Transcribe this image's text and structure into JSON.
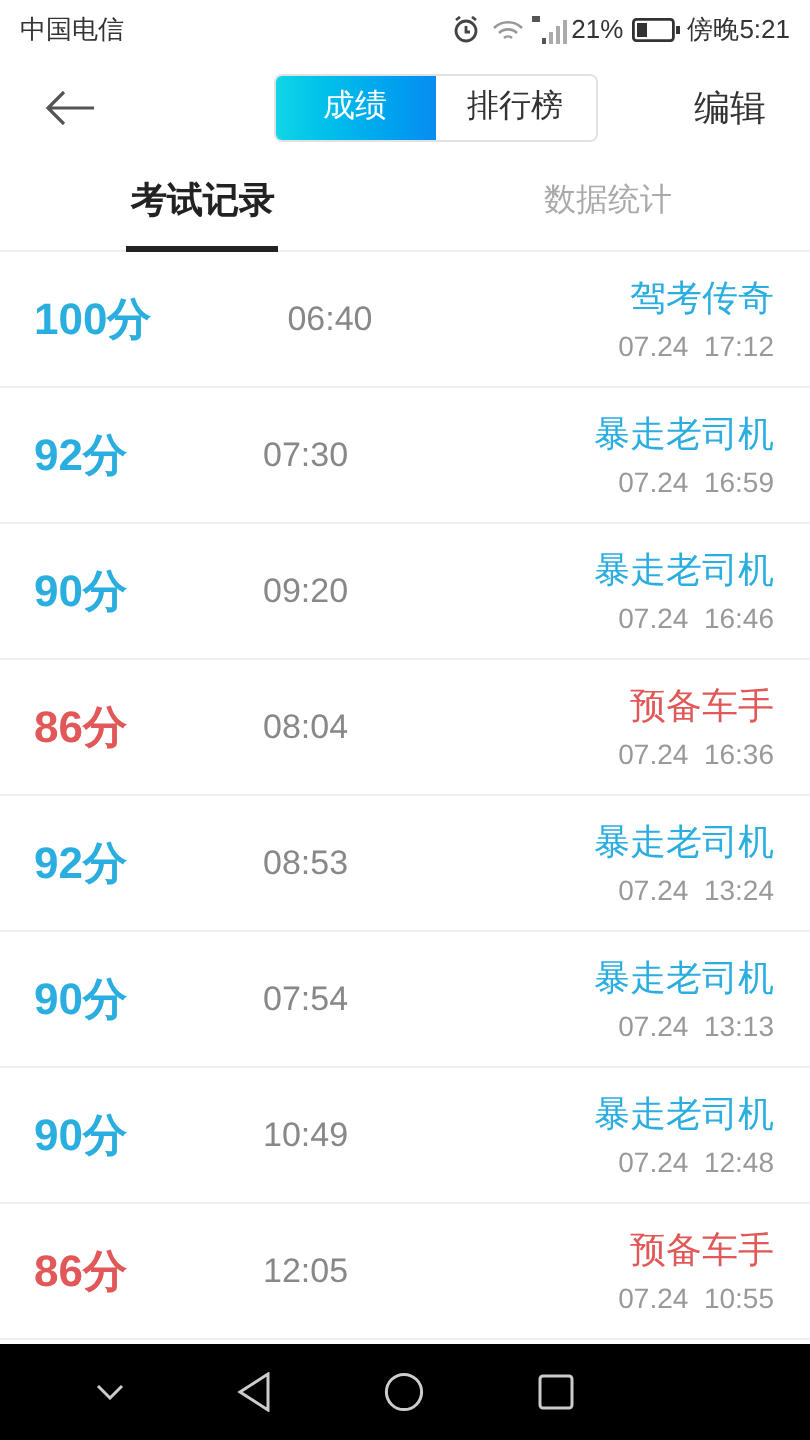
{
  "status_bar": {
    "carrier": "中国电信",
    "battery_percent": "21%",
    "time": "傍晚5:21"
  },
  "header": {
    "segments": [
      {
        "label": "成绩",
        "selected": true
      },
      {
        "label": "排行榜",
        "selected": false
      }
    ],
    "edit": "编辑"
  },
  "tabs": [
    {
      "label": "考试记录",
      "selected": true
    },
    {
      "label": "数据统计",
      "selected": false
    }
  ],
  "records": [
    {
      "score": "100分",
      "duration": "06:40",
      "title": "驾考传奇",
      "datetime": "07.24  17:12",
      "passed": true
    },
    {
      "score": "92分",
      "duration": "07:30",
      "title": "暴走老司机",
      "datetime": "07.24  16:59",
      "passed": true
    },
    {
      "score": "90分",
      "duration": "09:20",
      "title": "暴走老司机",
      "datetime": "07.24  16:46",
      "passed": true
    },
    {
      "score": "86分",
      "duration": "08:04",
      "title": "预备车手",
      "datetime": "07.24  16:36",
      "passed": false
    },
    {
      "score": "92分",
      "duration": "08:53",
      "title": "暴走老司机",
      "datetime": "07.24  13:24",
      "passed": true
    },
    {
      "score": "90分",
      "duration": "07:54",
      "title": "暴走老司机",
      "datetime": "07.24  13:13",
      "passed": true
    },
    {
      "score": "90分",
      "duration": "10:49",
      "title": "暴走老司机",
      "datetime": "07.24  12:48",
      "passed": true
    },
    {
      "score": "86分",
      "duration": "12:05",
      "title": "预备车手",
      "datetime": "07.24  10:55",
      "passed": false
    }
  ]
}
